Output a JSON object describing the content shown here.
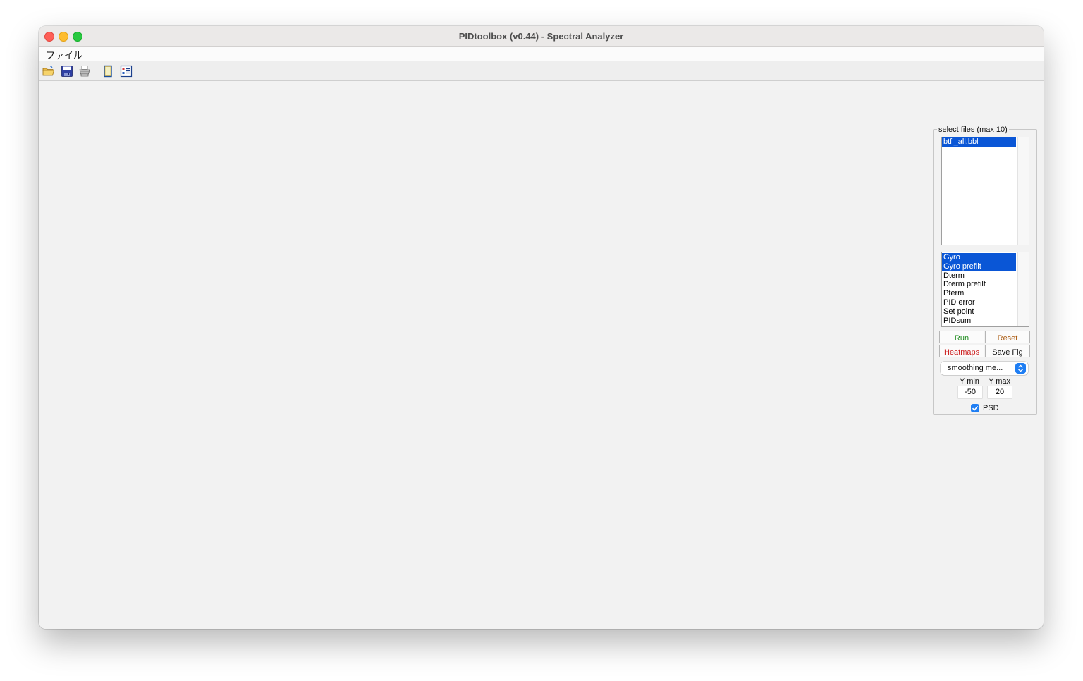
{
  "window": {
    "title": "PIDtoolbox (v0.44) - Spectral Analyzer"
  },
  "menu": {
    "file": "ファイル"
  },
  "toolbar": {
    "icons": [
      "open-folder-icon",
      "save-disk-icon",
      "print-icon",
      "blank-page-icon",
      "property-inspector-icon"
    ]
  },
  "panel": {
    "legend": "select files (max 10)",
    "files": [
      {
        "label": "btfl_all.bbl",
        "selected": true
      }
    ],
    "signals": [
      {
        "label": "Gyro",
        "selected": true
      },
      {
        "label": "Gyro prefilt",
        "selected": true
      },
      {
        "label": "Dterm",
        "selected": false
      },
      {
        "label": "Dterm prefilt",
        "selected": false
      },
      {
        "label": "Pterm",
        "selected": false
      },
      {
        "label": "PID error",
        "selected": false
      },
      {
        "label": "Set point",
        "selected": false
      },
      {
        "label": "PIDsum",
        "selected": false
      }
    ],
    "buttons": {
      "run": "Run",
      "reset": "Reset",
      "heatmaps": "Heatmaps",
      "save_fig": "Save Fig"
    },
    "colors": {
      "run": "#1a8a1a",
      "reset": "#a8560a",
      "heatmaps": "#cc1f1f",
      "save_fig": "#111111",
      "selection": "#0a56d6",
      "accent": "#1f7ef3"
    },
    "smoothing": {
      "selected": "smoothing me..."
    },
    "ymin": {
      "label": "Y min",
      "value": "-50"
    },
    "ymax": {
      "label": "Y max",
      "value": "20"
    },
    "psd": {
      "label": "PSD",
      "checked": true
    }
  }
}
